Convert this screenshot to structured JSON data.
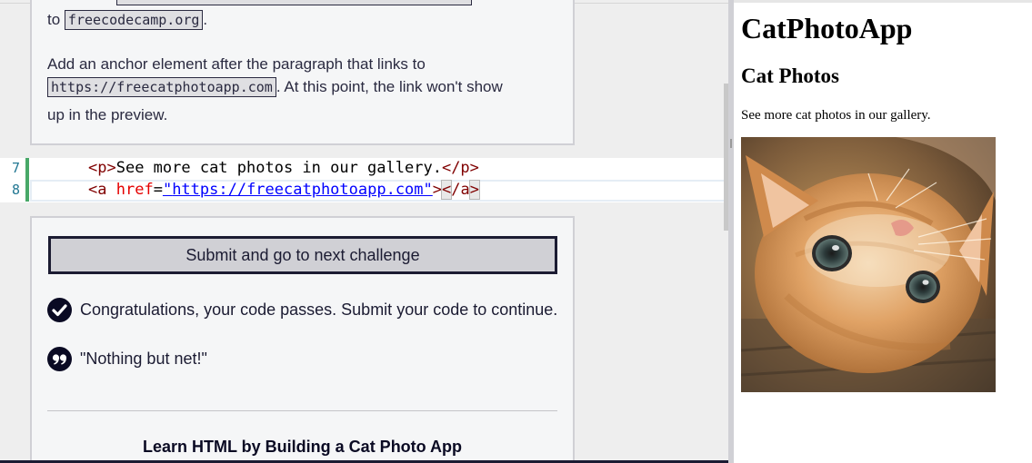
{
  "instructions": {
    "line1_prefix": "to",
    "line1_code": "freecodecamp.org",
    "line1_suffix": ".",
    "line2": "Add an anchor element after the paragraph that links to",
    "line3_code": "https://freecatphotoapp.com",
    "line3_suffix": ". At this point, the link won't show",
    "line4": "up in the preview."
  },
  "editor": {
    "lines": [
      {
        "number": "7",
        "open_tag": "<p>",
        "text": "See more cat photos in our gallery.",
        "close_tag": "</p>"
      },
      {
        "number": "8",
        "tag_open": "<a",
        "attr_name": "href",
        "equals": "=",
        "quote": "\"",
        "attr_value": "https://freecatphotoapp.com",
        "tag_gt": ">",
        "close_lt": "<",
        "close_rest": "/a",
        "close_gt": ">"
      }
    ]
  },
  "results": {
    "submit_label": "Submit and go to next challenge",
    "success_message": "Congratulations, your code passes. Submit your code to continue.",
    "quote": "\"Nothing but net!\"",
    "course_title": "Learn HTML by Building a Cat Photo App"
  },
  "preview": {
    "h1": "CatPhotoApp",
    "h2": "Cat Photos",
    "paragraph": "See more cat photos in our gallery.",
    "image_subject": "orange kitten lying on its back"
  },
  "colors": {
    "success_green": "#48a868",
    "dark_navy": "#1b1b32",
    "editor_tag": "#800000",
    "editor_attr": "#e50000",
    "editor_string": "#0000ff"
  }
}
